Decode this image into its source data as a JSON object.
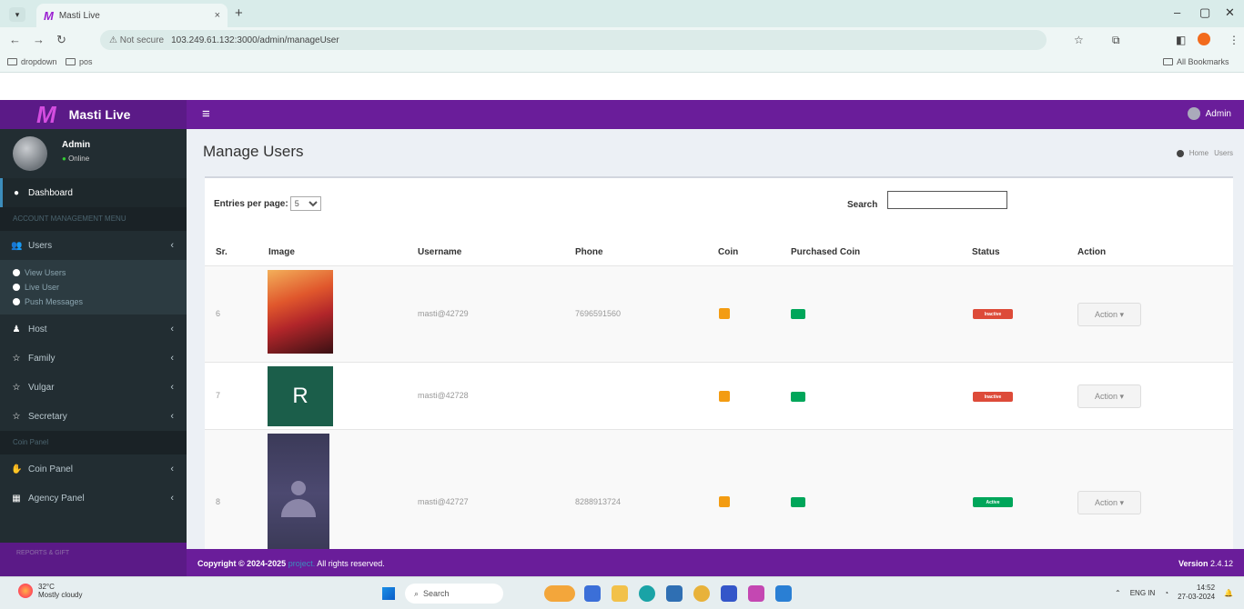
{
  "browser": {
    "tab_title": "Masti Live",
    "tab_logo": "M",
    "close_glyph": "×",
    "new_tab_glyph": "+",
    "security": "⚠ Not secure",
    "url": "103.249.61.132:3000/admin/manageUser",
    "bookmarks": [
      "dropdown",
      "pos"
    ],
    "all_bookmarks": "All Bookmarks"
  },
  "app": {
    "logo_letter": "M",
    "name": "Masti Live",
    "admin_label": "Admin",
    "menu_glyph": "≡"
  },
  "sidebar": {
    "user_name": "Admin",
    "user_status": "Online",
    "dashboard": "Dashboard",
    "section_header": "ACCOUNT MANAGEMENT MENU",
    "users": "Users",
    "sub_items": [
      "View Users",
      "Live User",
      "Push Messages"
    ],
    "host": "Host",
    "family": "Family",
    "vulgar": "Vulgar",
    "secretary": "Secretary",
    "coins_header": "Coin Panel",
    "coin_panel": "Coin Panel",
    "agency_panel": "Agency Panel",
    "bottom_header": "REPORTS & GIFT"
  },
  "page": {
    "title": "Manage Users",
    "breadcrumb_home": "Home",
    "breadcrumb_current": "Users",
    "entries_label": "Entries per page:",
    "entries_value": "5",
    "search_label": "Search"
  },
  "table": {
    "columns": [
      "Sr.",
      "Image",
      "Username",
      "Phone",
      "Coin",
      "Purchased Coin",
      "Status",
      "Action"
    ],
    "rows": [
      {
        "sr": "6",
        "username": "masti@42729",
        "phone": "7696591560",
        "status": "Inactive",
        "action": "Action ▾"
      },
      {
        "sr": "7",
        "username": "masti@42728",
        "phone": "",
        "avatar_letter": "R",
        "status": "Inactive",
        "action": "Action ▾"
      },
      {
        "sr": "8",
        "username": "masti@42727",
        "phone": "8288913724",
        "status": "Active",
        "action": "Action ▾"
      }
    ]
  },
  "footer": {
    "copyright": "Copyright © 2024-2025",
    "project": "project.",
    "rights": "All rights reserved.",
    "version_label": "Version",
    "version_value": "2.4.12"
  },
  "taskbar": {
    "temperature": "32°C",
    "weather": "Mostly cloudy",
    "search": "Search",
    "lang": "ENG IN",
    "time": "14:52",
    "date": "27-03-2024"
  },
  "colors": {
    "header_purple": "#6a1d9a",
    "logo_purple": "#5b1a87",
    "sidebar_bg": "#222d32",
    "inactive": "#dd4b39",
    "active": "#00a65a",
    "coin": "#f39c12"
  }
}
